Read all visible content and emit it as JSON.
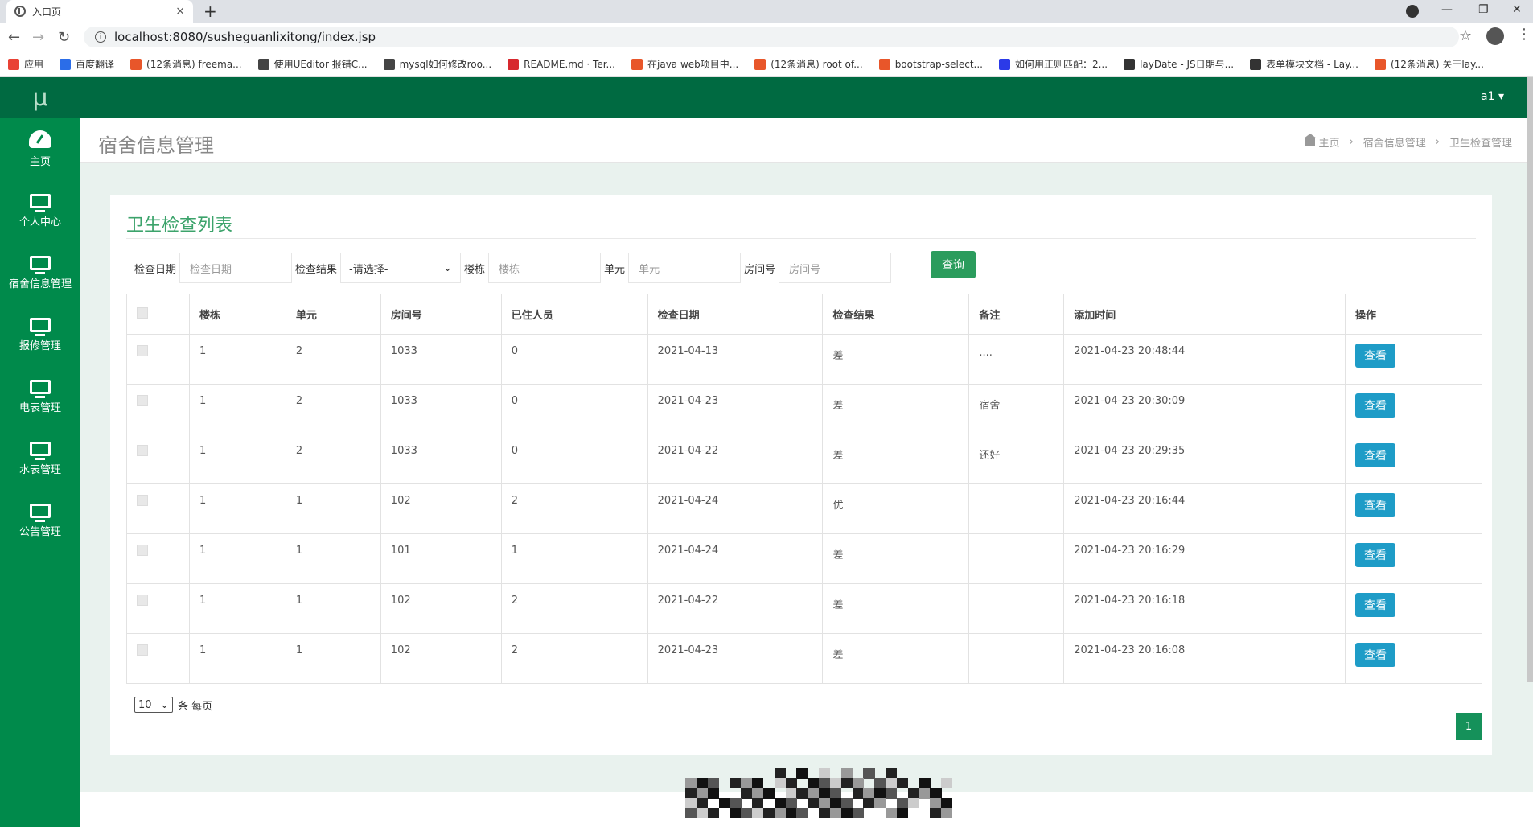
{
  "browser": {
    "tab_title": "入口页",
    "tab_close": "×",
    "new_tab": "+",
    "url": "localhost:8080/susheguanlixitong/index.jsp",
    "win_min": "—",
    "win_restore": "❐",
    "win_close": "✕",
    "bookmarks": [
      {
        "label": "应用",
        "color": "#e94235"
      },
      {
        "label": "百度翻译",
        "color": "#2b6de8"
      },
      {
        "label": "(12条消息) freema...",
        "color": "#e8562a"
      },
      {
        "label": "使用UEditor 报错C...",
        "color": "#444444"
      },
      {
        "label": "mysql如何修改roo...",
        "color": "#444444"
      },
      {
        "label": "README.md · Ter...",
        "color": "#d7282e"
      },
      {
        "label": "在java web项目中...",
        "color": "#e8562a"
      },
      {
        "label": "(12条消息) root of...",
        "color": "#e8562a"
      },
      {
        "label": "bootstrap-select...",
        "color": "#e8562a"
      },
      {
        "label": "如何用正则匹配：2...",
        "color": "#2b3ae8"
      },
      {
        "label": "layDate - JS日期与...",
        "color": "#333333"
      },
      {
        "label": "表单模块文档 - Lay...",
        "color": "#333333"
      },
      {
        "label": "(12条消息) 关于lay...",
        "color": "#e8562a"
      }
    ]
  },
  "app": {
    "logo": "μ",
    "user": "a1 ▾",
    "sidebar": [
      {
        "label": "主页",
        "icon": "dashboard-icon"
      },
      {
        "label": "个人中心",
        "icon": "monitor-icon"
      },
      {
        "label": "宿舍信息管理",
        "icon": "monitor-icon"
      },
      {
        "label": "报修管理",
        "icon": "monitor-icon"
      },
      {
        "label": "电表管理",
        "icon": "monitor-icon"
      },
      {
        "label": "水表管理",
        "icon": "monitor-icon"
      },
      {
        "label": "公告管理",
        "icon": "monitor-icon"
      }
    ],
    "page_title": "宿舍信息管理",
    "breadcrumb": {
      "home": "主页",
      "sep": "›",
      "level1": "宿舍信息管理",
      "level2": "卫生检查管理"
    }
  },
  "card": {
    "title": "卫生检查列表",
    "filters": {
      "date_label": "检查日期",
      "date_placeholder": "检查日期",
      "result_label": "检查结果",
      "result_selected": "-请选择-",
      "building_label": "楼栋",
      "building_placeholder": "楼栋",
      "unit_label": "单元",
      "unit_placeholder": "单元",
      "room_label": "房间号",
      "room_placeholder": "房间号",
      "query_button": "查询"
    },
    "table": {
      "headers": [
        "楼栋",
        "单元",
        "房间号",
        "已住人员",
        "检查日期",
        "检查结果",
        "备注",
        "添加时间",
        "操作"
      ],
      "view_label": "查看",
      "rows": [
        {
          "building": "1",
          "unit": "2",
          "room": "1033",
          "occupants": "0",
          "date": "2021-04-13",
          "result": "差",
          "note": "....",
          "added": "2021-04-23 20:48:44"
        },
        {
          "building": "1",
          "unit": "2",
          "room": "1033",
          "occupants": "0",
          "date": "2021-04-23",
          "result": "差",
          "note": "宿舍",
          "added": "2021-04-23 20:30:09"
        },
        {
          "building": "1",
          "unit": "2",
          "room": "1033",
          "occupants": "0",
          "date": "2021-04-22",
          "result": "差",
          "note": "还好",
          "added": "2021-04-23 20:29:35"
        },
        {
          "building": "1",
          "unit": "1",
          "room": "102",
          "occupants": "2",
          "date": "2021-04-24",
          "result": "优",
          "note": "",
          "added": "2021-04-23 20:16:44"
        },
        {
          "building": "1",
          "unit": "1",
          "room": "101",
          "occupants": "1",
          "date": "2021-04-24",
          "result": "差",
          "note": "",
          "added": "2021-04-23 20:16:29"
        },
        {
          "building": "1",
          "unit": "1",
          "room": "102",
          "occupants": "2",
          "date": "2021-04-22",
          "result": "差",
          "note": "",
          "added": "2021-04-23 20:16:18"
        },
        {
          "building": "1",
          "unit": "1",
          "room": "102",
          "occupants": "2",
          "date": "2021-04-23",
          "result": "差",
          "note": "",
          "added": "2021-04-23 20:16:08"
        }
      ]
    },
    "pager": {
      "page_size": "10",
      "per_page_label": "条 每页",
      "current_page": "1"
    }
  },
  "colors": {
    "sidebar": "#008a4b",
    "topbar": "#006a41",
    "accent_title": "#3ca36b",
    "view_button": "#1e9cc7",
    "query_button": "#2b9c5d"
  }
}
